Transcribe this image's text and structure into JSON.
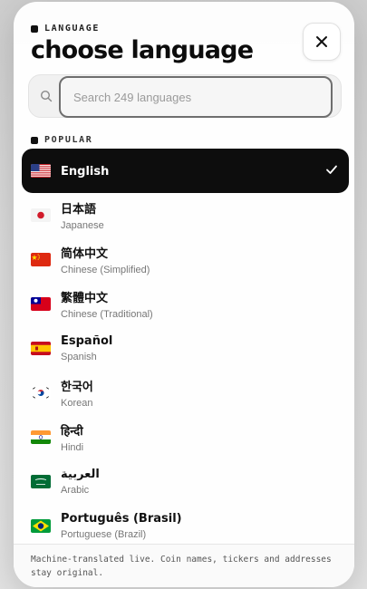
{
  "header": {
    "kicker": "LANGUAGE",
    "title": "choose language",
    "close_icon": "close-icon"
  },
  "search": {
    "placeholder": "Search 249 languages",
    "icon": "search-icon"
  },
  "section_label": "POPULAR",
  "languages": [
    {
      "native": "English",
      "english": "",
      "flag": "us",
      "selected": true
    },
    {
      "native": "日本語",
      "english": "Japanese",
      "flag": "jp",
      "selected": false
    },
    {
      "native": "简体中文",
      "english": "Chinese (Simplified)",
      "flag": "cn",
      "selected": false
    },
    {
      "native": "繁體中文",
      "english": "Chinese (Traditional)",
      "flag": "tw",
      "selected": false
    },
    {
      "native": "Español",
      "english": "Spanish",
      "flag": "es",
      "selected": false
    },
    {
      "native": "한국어",
      "english": "Korean",
      "flag": "kr",
      "selected": false
    },
    {
      "native": "हिन्दी",
      "english": "Hindi",
      "flag": "in",
      "selected": false
    },
    {
      "native": "العربية",
      "english": "Arabic",
      "flag": "sa",
      "selected": false
    },
    {
      "native": "Português (Brasil)",
      "english": "Portuguese (Brazil)",
      "flag": "br",
      "selected": false
    }
  ],
  "footer": {
    "note": "Machine-translated live. Coin names, tickers and addresses stay original."
  },
  "colors": {
    "selected_bg": "#0d0d0d",
    "text": "#111111",
    "muted": "#777777"
  }
}
